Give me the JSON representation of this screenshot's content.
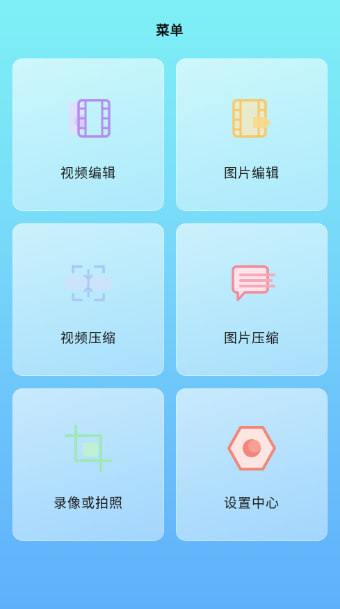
{
  "header": {
    "title": "菜单"
  },
  "menu": {
    "items": [
      {
        "label": "视频编辑",
        "icon": "video-edit-icon"
      },
      {
        "label": "图片编辑",
        "icon": "image-edit-icon"
      },
      {
        "label": "视频压缩",
        "icon": "video-compress-icon"
      },
      {
        "label": "图片压缩",
        "icon": "image-compress-icon"
      },
      {
        "label": "录像或拍照",
        "icon": "crop-camera-icon"
      },
      {
        "label": "设置中心",
        "icon": "settings-hexagon-icon"
      }
    ]
  },
  "colors": {
    "video_edit": "#b38cf0",
    "image_edit": "#f5c96a",
    "video_compress": "#a9c8f3",
    "image_compress": "#f28a9a",
    "crop_camera": "#9ee8b8",
    "settings": "#f3857a"
  }
}
